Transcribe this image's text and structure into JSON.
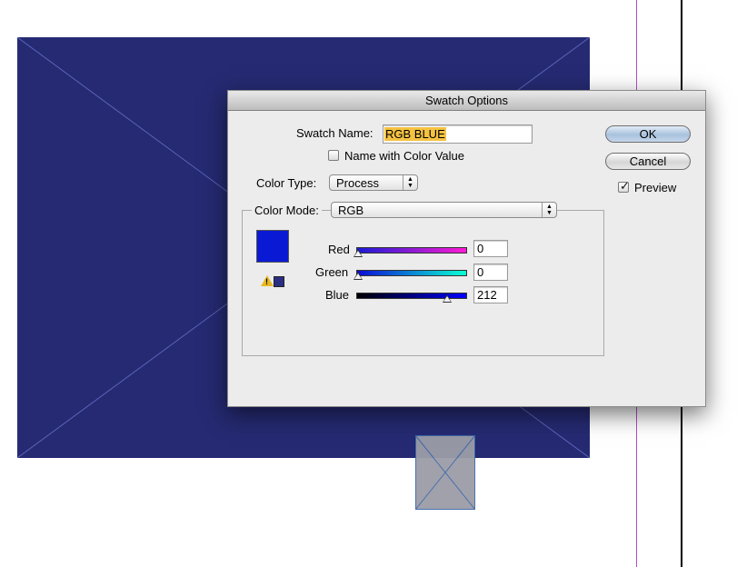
{
  "dialog": {
    "title": "Swatch Options",
    "swatch_name_label": "Swatch Name:",
    "swatch_name_value": "RGB BLUE",
    "name_with_color_value_label": "Name with Color Value",
    "name_with_color_value_checked": false,
    "color_type_label": "Color Type:",
    "color_type_value": "Process",
    "color_mode_label": "Color Mode:",
    "color_mode_value": "RGB",
    "preview_color": "#0a1ad4",
    "out_of_gamut_color": "#2a2f84",
    "channels": [
      {
        "name": "Red",
        "value": "0",
        "gradient": [
          "#1a1ad4",
          "#ff1ad4"
        ]
      },
      {
        "name": "Green",
        "value": "0",
        "gradient": [
          "#0a0ad4",
          "#0affd4"
        ]
      },
      {
        "name": "Blue",
        "value": "212",
        "gradient": [
          "#000000",
          "#0000ff"
        ]
      }
    ],
    "ok_label": "OK",
    "cancel_label": "Cancel",
    "preview_label": "Preview",
    "preview_checked": true
  },
  "canvas": {
    "frame_fill": "#252a72",
    "guide_color": "#b04fc7"
  }
}
